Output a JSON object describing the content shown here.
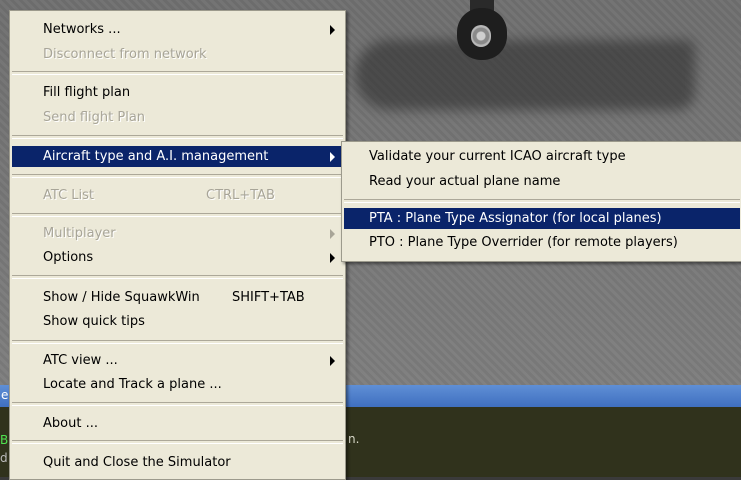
{
  "main_menu": {
    "networks": "Networks ...",
    "disconnect": "Disconnect from network",
    "fill_flight_plan": "Fill flight plan",
    "send_flight_plan": "Send flight Plan",
    "aircraft_type": "Aircraft type and A.I. management",
    "atc_list": "ATC List",
    "atc_list_shortcut": "CTRL+TAB",
    "multiplayer": "Multiplayer",
    "options": "Options",
    "show_hide_squawkwin": "Show / Hide SquawkWin",
    "show_hide_squawkwin_shortcut": "SHIFT+TAB",
    "show_quick_tips": "Show quick tips",
    "atc_view": "ATC view ...",
    "locate_track": "Locate and Track a plane ...",
    "about": "About ...",
    "quit": "Quit and Close the Simulator"
  },
  "submenu": {
    "validate": "Validate your current ICAO aircraft type",
    "read_plane_name": "Read your actual plane name",
    "pta": "PTA : Plane Type Assignator (for local planes)",
    "pto": "PTO : Plane Type Overrider (for remote players)"
  },
  "console": {
    "text_fragment": "n.",
    "left_char_1": "B",
    "left_char_2": "d",
    "bar_char": "e"
  },
  "colors": {
    "menu_bg": "#ece9d8",
    "highlight": "#0a246a",
    "disabled_text": "#a8a598"
  }
}
